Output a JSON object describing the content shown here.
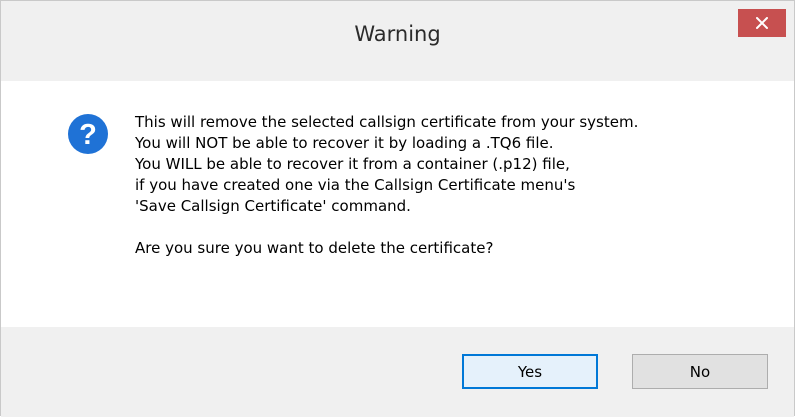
{
  "window": {
    "title": "Warning",
    "close_icon": "close-icon"
  },
  "message": {
    "icon": "question-icon",
    "lines": [
      "This will remove the selected callsign certificate from your system.",
      "You will NOT be able to recover it by loading a .TQ6 file.",
      "You WILL be able to recover it from a container (.p12) file,",
      "if you have created one via the Callsign Certificate menu's",
      "'Save Callsign Certificate' command."
    ],
    "question": "Are you sure you want to delete the certificate?"
  },
  "buttons": {
    "yes_label": "Yes",
    "no_label": "No"
  },
  "colors": {
    "close_button": "#c75050",
    "question_icon": "#1f72d6",
    "default_button_border": "#0078d7"
  }
}
